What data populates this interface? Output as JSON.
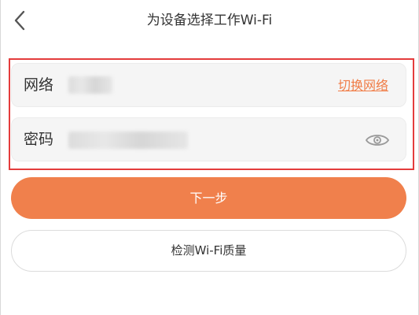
{
  "header": {
    "title": "为设备选择工作Wi-Fi",
    "back_icon": "chevron-left-icon"
  },
  "form": {
    "network_label": "网络",
    "switch_network_link": "切换网络",
    "password_label": "密码",
    "password_visibility_icon": "eye-icon",
    "highlight_color": "#e43c3c"
  },
  "actions": {
    "next_label": "下一步",
    "check_wifi_label": "检测Wi-Fi质量"
  },
  "colors": {
    "accent": "#f0804c",
    "link": "#f07c46",
    "field_background": "#f5f5f5"
  }
}
